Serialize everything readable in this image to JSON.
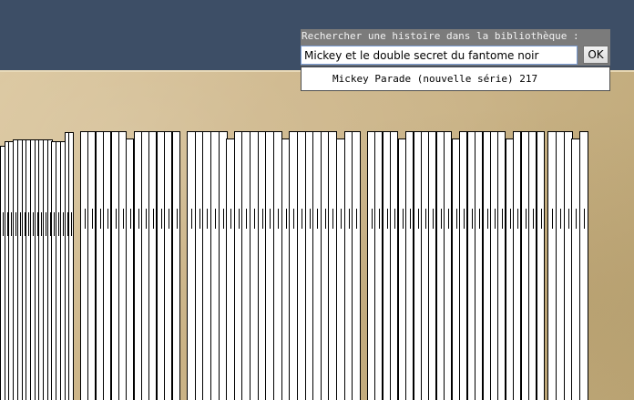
{
  "search": {
    "label": "Rechercher une histoire dans la bibliothèque :",
    "query": "Mickey et le double secret du fantome noir",
    "ok_label": "OK"
  },
  "suggestions": [
    "Mickey Parade (nouvelle série) 217"
  ],
  "shelf": {
    "spine_count": 105
  }
}
